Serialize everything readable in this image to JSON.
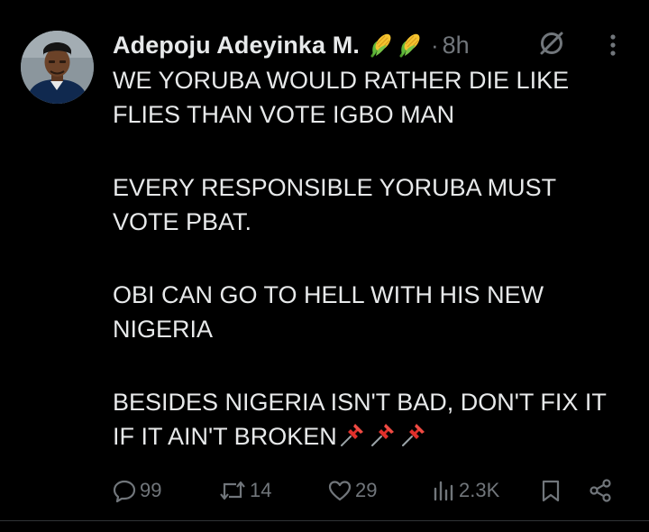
{
  "author": {
    "name": "Adepoju Adeyinka M.",
    "badges": [
      "corn-emoji",
      "corn-emoji"
    ],
    "separator": "·",
    "time": "8h"
  },
  "tweet": {
    "paragraphs": [
      "WE YORUBA WOULD RATHER DIE LIKE FLIES THAN VOTE IGBO MAN",
      "EVERY RESPONSIBLE YORUBA MUST VOTE PBAT.",
      "OBI CAN GO TO HELL WITH HIS NEW NIGERIA",
      "BESIDES NIGERIA ISN'T BAD, DON'T FIX IT IF IT AIN'T BROKEN"
    ],
    "trailing_emoji": [
      "pushpin-emoji",
      "pushpin-emoji",
      "pushpin-emoji"
    ]
  },
  "actions": {
    "replies": "99",
    "reposts": "14",
    "likes": "29",
    "views": "2.3K"
  },
  "colors": {
    "background": "#000000",
    "text": "#e7e9ea",
    "secondary": "#71767b"
  }
}
